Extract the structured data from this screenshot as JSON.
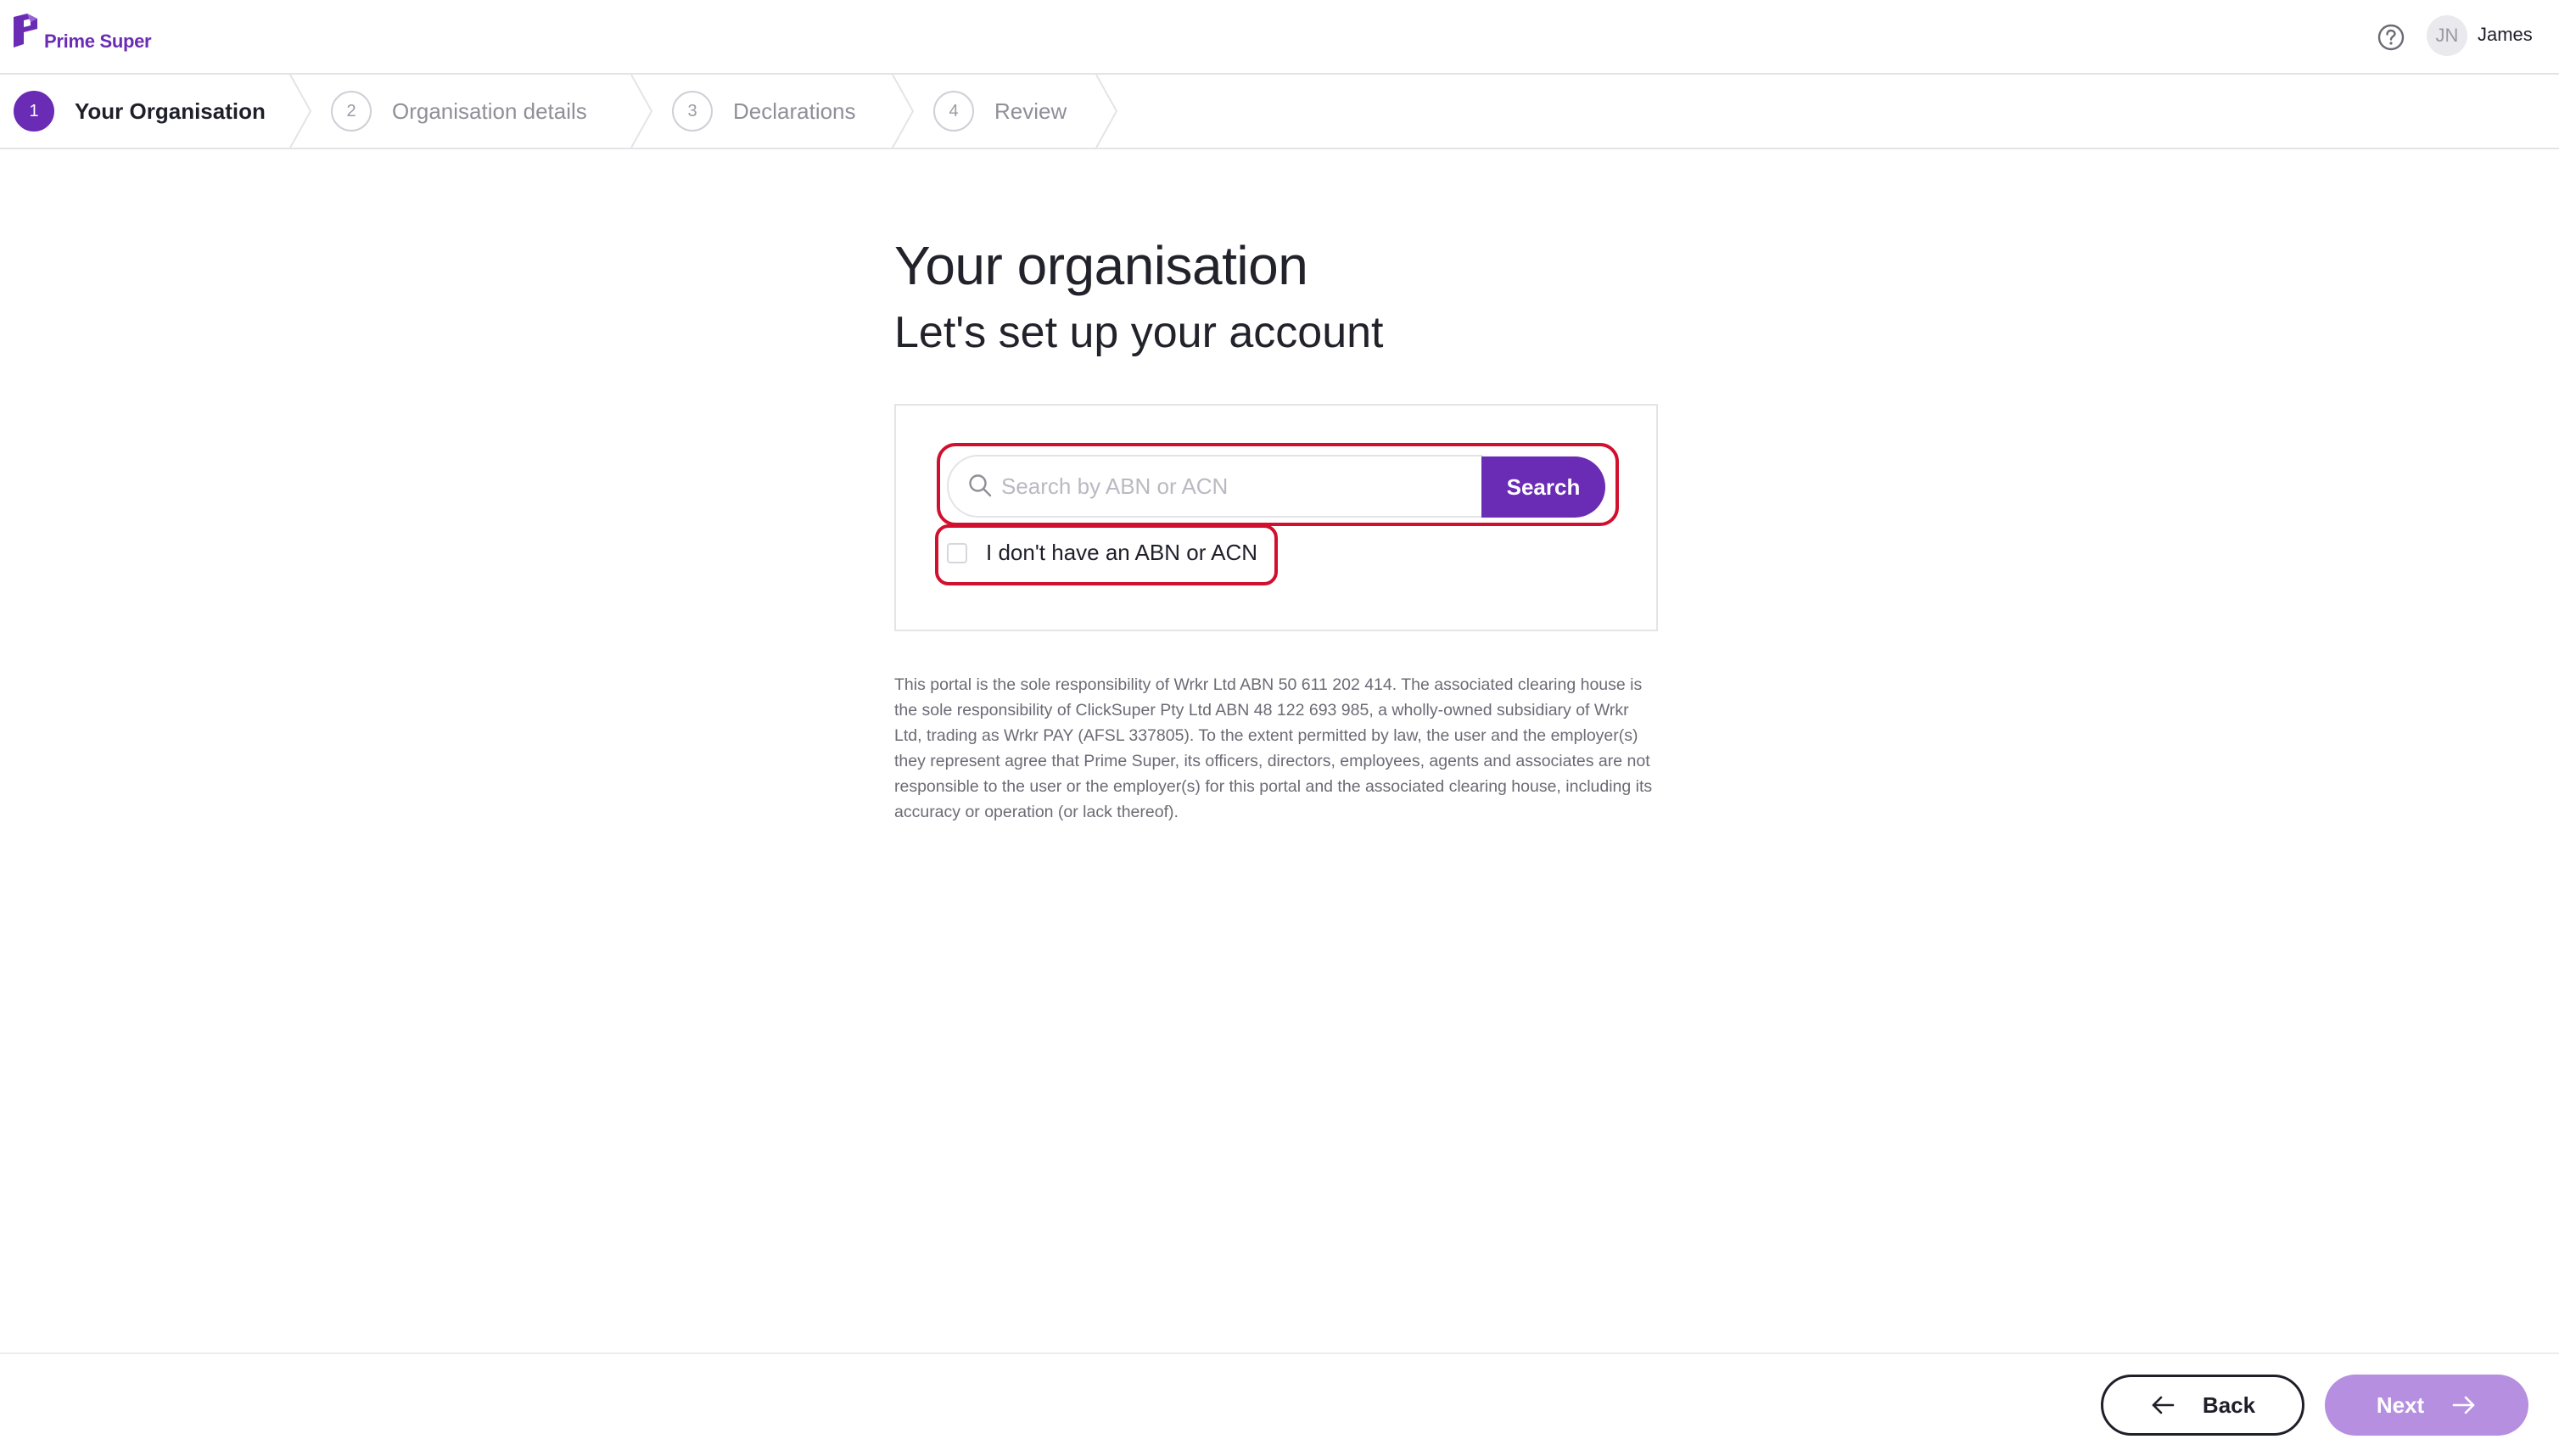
{
  "header": {
    "brand": "Prime Super",
    "help_icon": "help-circle-icon",
    "avatar_initials": "JN",
    "user_name": "James"
  },
  "stepper": {
    "steps": [
      {
        "number": "1",
        "label": "Your Organisation",
        "active": true
      },
      {
        "number": "2",
        "label": "Organisation details",
        "active": false
      },
      {
        "number": "3",
        "label": "Declarations",
        "active": false
      },
      {
        "number": "4",
        "label": "Review",
        "active": false
      }
    ]
  },
  "main": {
    "title": "Your organisation",
    "subtitle": "Let's set up your account",
    "search": {
      "placeholder": "Search by ABN or ACN",
      "value": "",
      "button_label": "Search"
    },
    "no_abn": {
      "label": "I don't have an ABN or ACN",
      "checked": false
    },
    "disclaimer": "This portal is the sole responsibility of Wrkr Ltd ABN 50 611 202 414. The associated clearing house is the sole responsibility of ClickSuper Pty Ltd ABN 48 122 693 985, a wholly-owned subsidiary of Wrkr Ltd, trading as Wrkr PAY (AFSL 337805). To the extent permitted by law, the user and the employer(s) they represent agree that Prime Super, its officers, directors, employees, agents and associates are not responsible to the user or the employer(s) for this portal and the associated clearing house, including its accuracy or operation (or lack thereof)."
  },
  "footer": {
    "back_label": "Back",
    "next_label": "Next"
  },
  "colors": {
    "brand": "#6a2bb5",
    "next_disabled": "#b68fe0",
    "highlight_outline": "#d0102e"
  }
}
